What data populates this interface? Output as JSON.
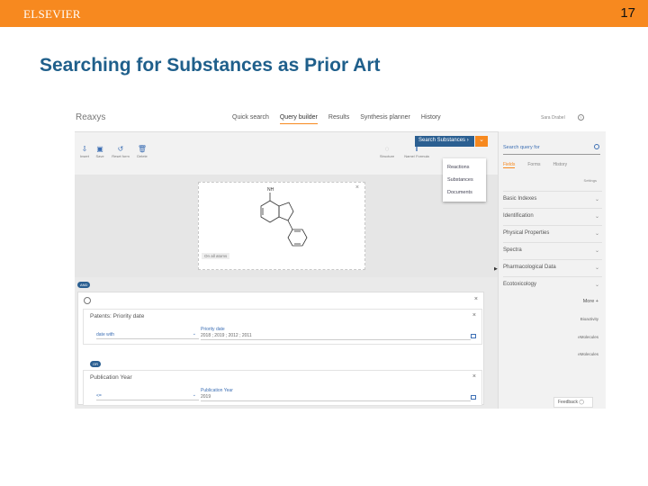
{
  "slide": {
    "brand": "ELSEVIER",
    "page_number": "17",
    "title": "Searching for Substances as Prior Art",
    "colors": {
      "header_orange": "#f7891f",
      "title_blue": "#1f5f8b",
      "reaxys_blue": "#2b5f91"
    }
  },
  "app": {
    "logo": "Reaxys",
    "nav": [
      "Quick search",
      "Query builder",
      "Results",
      "Synthesis planner",
      "History"
    ],
    "nav_active": "Query builder",
    "user": "Sara Drabel",
    "help_icon": "?"
  },
  "toolbar": {
    "tools": [
      {
        "icon": "import-icon",
        "glyph": "⇩",
        "label": "Insert"
      },
      {
        "icon": "save-icon",
        "glyph": "▣",
        "label": "Save"
      },
      {
        "icon": "reset-icon",
        "glyph": "↺",
        "label": "Reset form"
      },
      {
        "icon": "delete-icon",
        "glyph": "🗑",
        "label": "Delete"
      }
    ],
    "right_tools": [
      {
        "icon": "undo-icon",
        "glyph": "◌",
        "label": "Structure"
      },
      {
        "icon": "formula-icon",
        "glyph": "‖",
        "label": "Name/ Formula"
      }
    ],
    "search_button": "Search Substances",
    "search_menu": [
      "Reactions",
      "Substances",
      "Documents"
    ]
  },
  "canvas": {
    "on_all_atoms": "On all atoms",
    "atom_label": "NH",
    "close": "×"
  },
  "filters": {
    "and_badge": "AND",
    "or_badge": "OR",
    "boxes": [
      {
        "title": "Patents: Priority date",
        "operator": "date with",
        "field_label": "Priority date",
        "field_value": "2018 ; 2019 ; 2012 ; 2011"
      },
      {
        "title": "Publication Year",
        "operator": "<=",
        "field_label": "Publication Year",
        "field_value": "2019"
      }
    ]
  },
  "sidebar": {
    "search_placeholder": "Search query for",
    "tabs": [
      "Fields",
      "Forms",
      "History"
    ],
    "active_tab": "Fields",
    "settings": "Settings",
    "items": [
      "Basic Indexes",
      "Identification",
      "Physical Properties",
      "Spectra",
      "Pharmacological Data",
      "Ecotoxicology"
    ],
    "more": "More",
    "sub_items": [
      "Bioactivity",
      "eMolecules",
      "eMolecules"
    ],
    "feedback": "Feedback"
  }
}
